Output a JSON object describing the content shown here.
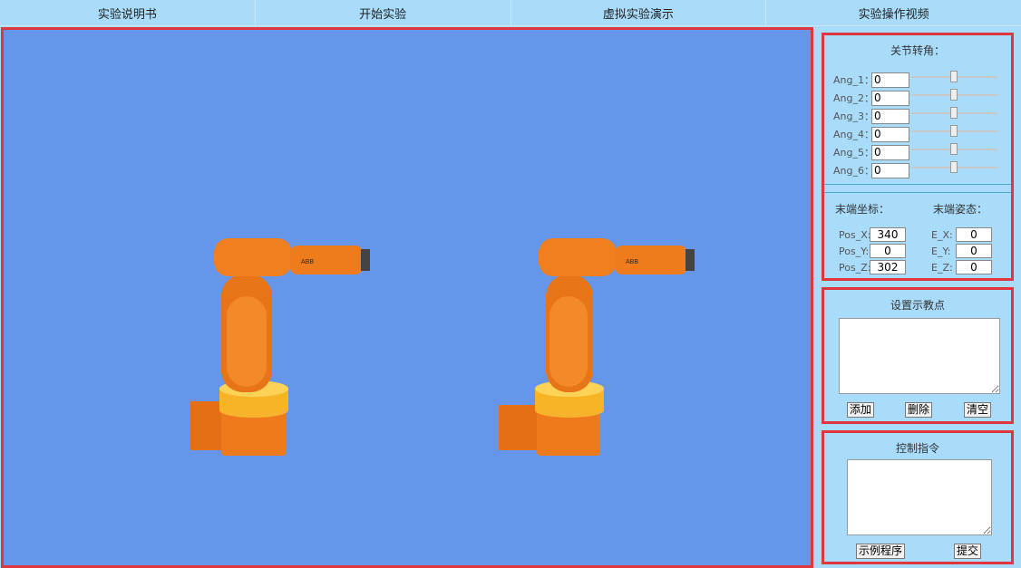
{
  "nav": [
    "实验说明书",
    "开始实验",
    "虚拟实验演示",
    "实验操作视频"
  ],
  "joints": {
    "title": "关节转角：",
    "rows": [
      {
        "label": "Ang_1：",
        "value": "0"
      },
      {
        "label": "Ang_2：",
        "value": "0"
      },
      {
        "label": "Ang_3：",
        "value": "0"
      },
      {
        "label": "Ang_4：",
        "value": "0"
      },
      {
        "label": "Ang_5：",
        "value": "0"
      },
      {
        "label": "Ang_6：",
        "value": "0"
      }
    ]
  },
  "end": {
    "pos_title": "末端坐标：",
    "pose_title": "末端姿态：",
    "pos": [
      {
        "label": "Pos_X:",
        "value": "340"
      },
      {
        "label": "Pos_Y:",
        "value": "0"
      },
      {
        "label": "Pos_Z:",
        "value": "302"
      }
    ],
    "pose": [
      {
        "label": "E_X:",
        "value": "0"
      },
      {
        "label": "E_Y:",
        "value": "0"
      },
      {
        "label": "E_Z:",
        "value": "0"
      }
    ]
  },
  "teach": {
    "title": "设置示教点",
    "add": "添加",
    "del": "删除",
    "clear": "清空"
  },
  "control": {
    "title": "控制指令",
    "example": "示例程序",
    "submit": "提交"
  },
  "robot_brand": "ABB",
  "colors": {
    "viewport": "#6596ea",
    "robot": "#f07a1a",
    "border": "#e0363d",
    "panel": "#a8dcfa"
  }
}
